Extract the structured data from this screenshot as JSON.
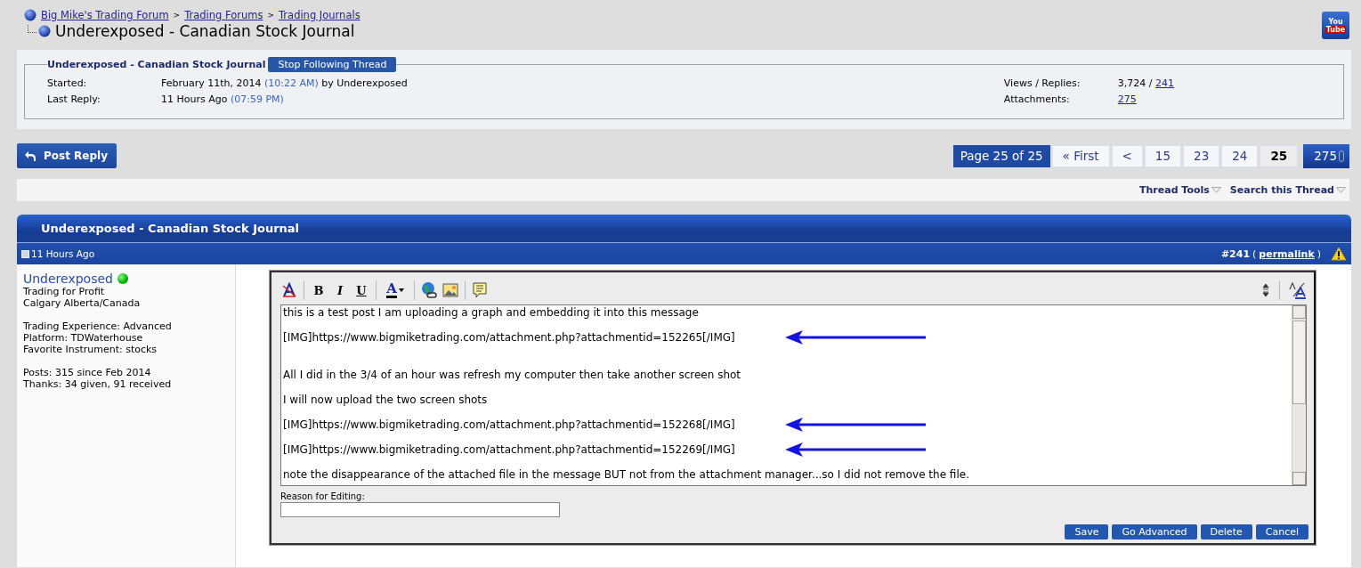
{
  "breadcrumb": [
    {
      "kind": "link",
      "text": "Big Mike's Trading Forum"
    },
    {
      "kind": "sep",
      "text": ">"
    },
    {
      "kind": "link",
      "text": "Trading Forums"
    },
    {
      "kind": "sep",
      "text": ">"
    },
    {
      "kind": "link",
      "text": "Trading Journals"
    }
  ],
  "page_title": "Underexposed - Canadian Stock Journal",
  "youtube_badge": {
    "top": "You",
    "bottom": "Tube"
  },
  "thread_info": {
    "title": "Underexposed - Canadian Stock Journal",
    "follow_button": "Stop Following Thread",
    "left": [
      {
        "label": "Started:",
        "parts": [
          {
            "kind": "plain",
            "text": "February 11th, 2014 "
          },
          {
            "kind": "time",
            "text": "(10:22 AM)"
          },
          {
            "kind": "plain",
            "text": " by Underexposed"
          }
        ]
      },
      {
        "label": "Last Reply:",
        "parts": [
          {
            "kind": "plain",
            "text": "11 Hours Ago "
          },
          {
            "kind": "time",
            "text": "(07:59 PM)"
          }
        ]
      }
    ],
    "right": [
      {
        "label": "Views / Replies:",
        "parts": [
          {
            "kind": "plain",
            "text": "3,724 / "
          },
          {
            "kind": "link",
            "text": "241"
          }
        ]
      },
      {
        "label": "Attachments:",
        "parts": [
          {
            "kind": "link",
            "text": "275"
          }
        ]
      }
    ]
  },
  "post_reply_button": "Post Reply",
  "pagination": {
    "label": "Page 25 of 25",
    "pages": [
      {
        "text": "« First",
        "selected": false
      },
      {
        "text": "<",
        "selected": false
      },
      {
        "text": "15",
        "selected": false
      },
      {
        "text": "23",
        "selected": false
      },
      {
        "text": "24",
        "selected": false
      },
      {
        "text": "25",
        "selected": true
      }
    ],
    "attachments": "275"
  },
  "thread_tools": [
    "Thread Tools",
    "Search this Thread"
  ],
  "post": {
    "header": "Underexposed - Canadian Stock Journal",
    "time": "11 Hours Ago",
    "number": "#241",
    "permalink_open": "(",
    "permalink": "permalink",
    "permalink_close": ")",
    "user": {
      "name": "Underexposed",
      "online": true,
      "details": [
        [
          "Trading for Profit",
          "Calgary Alberta/Canada"
        ],
        [
          "Trading Experience: Advanced",
          "Platform: TDWaterhouse",
          "Favorite Instrument: stocks"
        ],
        [
          "Posts: 315 since Feb 2014",
          "Thanks: 34 given, 91 received"
        ]
      ]
    },
    "editor": {
      "toolbar": [
        {
          "kind": "remove-format"
        },
        {
          "kind": "sep"
        },
        {
          "kind": "bold",
          "label": "B"
        },
        {
          "kind": "italic",
          "label": "I"
        },
        {
          "kind": "underline",
          "label": "U"
        },
        {
          "kind": "sep"
        },
        {
          "kind": "color",
          "label": "A"
        },
        {
          "kind": "sep"
        },
        {
          "kind": "link"
        },
        {
          "kind": "image"
        },
        {
          "kind": "sep"
        },
        {
          "kind": "quote"
        }
      ],
      "lines": [
        {
          "kind": "text",
          "text": "this is a test post I am uploading a graph and embedding it into this message",
          "arrow": false
        },
        {
          "kind": "blank"
        },
        {
          "kind": "text",
          "text": "[IMG]https://www.bigmiketrading.com/attachment.php?attachmentid=152265[/IMG]",
          "arrow": true
        },
        {
          "kind": "blank"
        },
        {
          "kind": "blank"
        },
        {
          "kind": "text",
          "text": "All I did in the 3/4 of an hour was refresh my computer then take another screen shot",
          "arrow": false
        },
        {
          "kind": "blank"
        },
        {
          "kind": "text",
          "text": "I will now upload the two screen shots",
          "arrow": false
        },
        {
          "kind": "blank"
        },
        {
          "kind": "text",
          "text": "[IMG]https://www.bigmiketrading.com/attachment.php?attachmentid=152268[/IMG]",
          "arrow": true
        },
        {
          "kind": "blank"
        },
        {
          "kind": "text",
          "text": "[IMG]https://www.bigmiketrading.com/attachment.php?attachmentid=152269[/IMG]",
          "arrow": true
        },
        {
          "kind": "blank"
        },
        {
          "kind": "text",
          "text": "note the disappearance of the attached file in the message BUT not from the attachment manager...so I did not remove the file.",
          "arrow": false
        }
      ],
      "reason_label": "Reason for Editing:",
      "buttons": [
        "Save",
        "Go Advanced",
        "Delete",
        "Cancel"
      ]
    }
  }
}
